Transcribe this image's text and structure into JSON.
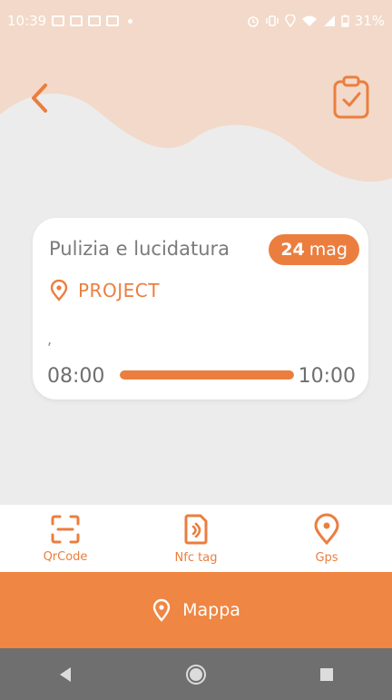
{
  "status_bar": {
    "time": "10:39",
    "battery": "31%",
    "left_icons": [
      "image-icon",
      "message-icon",
      "mail-icon",
      "calendar-icon"
    ],
    "right_icons": [
      "alarm-icon",
      "vibrate-icon",
      "location-icon",
      "wifi-icon",
      "signal-icon",
      "battery-icon"
    ]
  },
  "header": {
    "back_icon": "chevron-left-icon",
    "action_icon": "clipboard-check-icon"
  },
  "task_card": {
    "title": "Pulizia e lucidatura",
    "date_day": "24",
    "date_month": "mag",
    "location_icon": "location-pin-icon",
    "project": "PROJECT",
    "note": ",",
    "time_start": "08:00",
    "time_end": "10:00",
    "progress": 1.0
  },
  "scan_options": [
    {
      "label": "QrCode",
      "icon": "qrcode-icon"
    },
    {
      "label": "Nfc tag",
      "icon": "nfc-icon"
    },
    {
      "label": "Gps",
      "icon": "location-pin-icon"
    }
  ],
  "map_button": {
    "label": "Mappa",
    "icon": "location-pin-icon"
  },
  "colors": {
    "accent": "#eb7e3f",
    "map_bar": "#ef8643",
    "header_wave": "#f3d9c9",
    "background": "#ececec",
    "nav_bar": "#6f6f6f"
  }
}
